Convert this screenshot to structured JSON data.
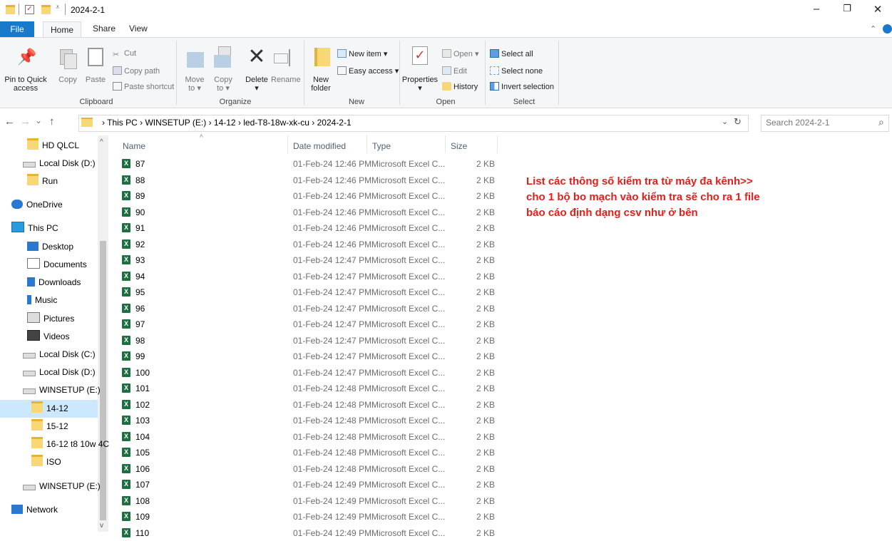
{
  "window": {
    "title": "2024-2-1",
    "controls": {
      "minimize": "–",
      "maximize": "❐",
      "close": "✕"
    }
  },
  "ribbon_tabs": [
    "File",
    "Home",
    "Share",
    "View"
  ],
  "ribbon": {
    "clipboard": {
      "label": "Clipboard",
      "pin_line1": "Pin to Quick",
      "pin_line2": "access",
      "copy": "Copy",
      "paste": "Paste",
      "cut": "Cut",
      "copy_path": "Copy path",
      "paste_shortcut": "Paste shortcut"
    },
    "organize": {
      "label": "Organize",
      "move_to_1": "Move",
      "move_to_2": "to ▾",
      "copy_to_1": "Copy",
      "copy_to_2": "to ▾",
      "delete": "Delete",
      "delete_arrow": "▾",
      "rename": "Rename"
    },
    "new": {
      "label": "New",
      "new_folder_1": "New",
      "new_folder_2": "folder",
      "new_item": "New item ▾",
      "easy_access": "Easy access ▾"
    },
    "open": {
      "label": "Open",
      "properties": "Properties",
      "properties_arrow": "▾",
      "open": "Open ▾",
      "edit": "Edit",
      "history": "History"
    },
    "select": {
      "label": "Select",
      "select_all": "Select all",
      "select_none": "Select none",
      "invert": "Invert selection"
    }
  },
  "address": {
    "nav_back": "←",
    "nav_forward": "→",
    "nav_recent": "⌄",
    "nav_up": "↑",
    "crumbs": "›  This PC  ›  WINSETUP (E:)  ›  14-12  ›  led-T8-18w-xk-cu  ›  2024-2-1",
    "dropdown": "⌄",
    "refresh": "↻",
    "search_placeholder": "Search 2024-2-1",
    "search_icon": "⌕"
  },
  "nav_pane": [
    {
      "label": "HD QLCL",
      "icon": "folder-icon"
    },
    {
      "label": "Local Disk (D:)",
      "icon": "drive-icon"
    },
    {
      "label": "Run",
      "icon": "folder-icon"
    },
    {
      "label": "OneDrive",
      "icon": "cloud-icon"
    },
    {
      "label": "This PC",
      "icon": "computer-icon"
    },
    {
      "label": "Desktop",
      "icon": "desktop-icon"
    },
    {
      "label": "Documents",
      "icon": "documents-icon"
    },
    {
      "label": "Downloads",
      "icon": "downloads-icon"
    },
    {
      "label": "Music",
      "icon": "music-icon"
    },
    {
      "label": "Pictures",
      "icon": "pictures-icon"
    },
    {
      "label": "Videos",
      "icon": "videos-icon"
    },
    {
      "label": "Local Disk (C:)",
      "icon": "drive-icon"
    },
    {
      "label": "Local Disk (D:)",
      "icon": "drive-icon"
    },
    {
      "label": "WINSETUP (E:)",
      "icon": "drive-icon"
    },
    {
      "label": "14-12",
      "icon": "folder-icon",
      "selected": true
    },
    {
      "label": "15-12",
      "icon": "folder-icon"
    },
    {
      "label": "16-12 t8 10w 4C",
      "icon": "folder-icon"
    },
    {
      "label": "ISO",
      "icon": "folder-icon"
    },
    {
      "label": "WINSETUP (E:)",
      "icon": "drive-icon"
    },
    {
      "label": "Network",
      "icon": "network-icon"
    }
  ],
  "columns": {
    "name": "Name",
    "date": "Date modified",
    "type": "Type",
    "size": "Size",
    "sort_arrow": "^"
  },
  "files": [
    {
      "name": "87",
      "date": "01-Feb-24 12:46 PM",
      "type": "Microsoft Excel C...",
      "size": "2 KB"
    },
    {
      "name": "88",
      "date": "01-Feb-24 12:46 PM",
      "type": "Microsoft Excel C...",
      "size": "2 KB"
    },
    {
      "name": "89",
      "date": "01-Feb-24 12:46 PM",
      "type": "Microsoft Excel C...",
      "size": "2 KB"
    },
    {
      "name": "90",
      "date": "01-Feb-24 12:46 PM",
      "type": "Microsoft Excel C...",
      "size": "2 KB"
    },
    {
      "name": "91",
      "date": "01-Feb-24 12:46 PM",
      "type": "Microsoft Excel C...",
      "size": "2 KB"
    },
    {
      "name": "92",
      "date": "01-Feb-24 12:46 PM",
      "type": "Microsoft Excel C...",
      "size": "2 KB"
    },
    {
      "name": "93",
      "date": "01-Feb-24 12:47 PM",
      "type": "Microsoft Excel C...",
      "size": "2 KB"
    },
    {
      "name": "94",
      "date": "01-Feb-24 12:47 PM",
      "type": "Microsoft Excel C...",
      "size": "2 KB"
    },
    {
      "name": "95",
      "date": "01-Feb-24 12:47 PM",
      "type": "Microsoft Excel C...",
      "size": "2 KB"
    },
    {
      "name": "96",
      "date": "01-Feb-24 12:47 PM",
      "type": "Microsoft Excel C...",
      "size": "2 KB"
    },
    {
      "name": "97",
      "date": "01-Feb-24 12:47 PM",
      "type": "Microsoft Excel C...",
      "size": "2 KB"
    },
    {
      "name": "98",
      "date": "01-Feb-24 12:47 PM",
      "type": "Microsoft Excel C...",
      "size": "2 KB"
    },
    {
      "name": "99",
      "date": "01-Feb-24 12:47 PM",
      "type": "Microsoft Excel C...",
      "size": "2 KB"
    },
    {
      "name": "100",
      "date": "01-Feb-24 12:47 PM",
      "type": "Microsoft Excel C...",
      "size": "2 KB"
    },
    {
      "name": "101",
      "date": "01-Feb-24 12:48 PM",
      "type": "Microsoft Excel C...",
      "size": "2 KB"
    },
    {
      "name": "102",
      "date": "01-Feb-24 12:48 PM",
      "type": "Microsoft Excel C...",
      "size": "2 KB"
    },
    {
      "name": "103",
      "date": "01-Feb-24 12:48 PM",
      "type": "Microsoft Excel C...",
      "size": "2 KB"
    },
    {
      "name": "104",
      "date": "01-Feb-24 12:48 PM",
      "type": "Microsoft Excel C...",
      "size": "2 KB"
    },
    {
      "name": "105",
      "date": "01-Feb-24 12:48 PM",
      "type": "Microsoft Excel C...",
      "size": "2 KB"
    },
    {
      "name": "106",
      "date": "01-Feb-24 12:48 PM",
      "type": "Microsoft Excel C...",
      "size": "2 KB"
    },
    {
      "name": "107",
      "date": "01-Feb-24 12:49 PM",
      "type": "Microsoft Excel C...",
      "size": "2 KB"
    },
    {
      "name": "108",
      "date": "01-Feb-24 12:49 PM",
      "type": "Microsoft Excel C...",
      "size": "2 KB"
    },
    {
      "name": "109",
      "date": "01-Feb-24 12:49 PM",
      "type": "Microsoft Excel C...",
      "size": "2 KB"
    },
    {
      "name": "110",
      "date": "01-Feb-24 12:49 PM",
      "type": "Microsoft Excel C...",
      "size": "2 KB"
    }
  ],
  "annotation": {
    "line1": "List các thông số kiểm tra từ máy đa kênh>>",
    "line2": "cho 1 bộ bo mạch vào kiểm tra sẽ cho ra 1 file",
    "line3": "báo cáo định dạng csv như ở bên"
  },
  "colors": {
    "accent": "#1979ca",
    "annotation": "#e0201b",
    "excel": "#1d6f42",
    "selection": "#cce8ff"
  }
}
